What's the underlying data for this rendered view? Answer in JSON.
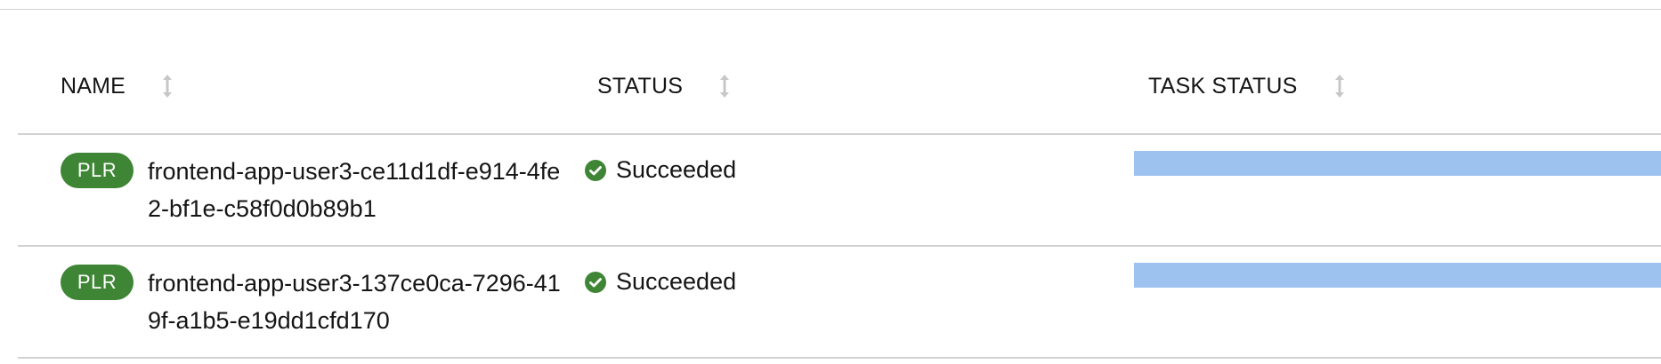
{
  "table": {
    "columns": [
      {
        "label": "NAME"
      },
      {
        "label": "STATUS"
      },
      {
        "label": "TASK STATUS"
      }
    ],
    "rows": [
      {
        "badge": "PLR",
        "name": "frontend-app-user3-ce11d1df-e914-4fe2-bf1e-c58f0d0b89b1",
        "status": "Succeeded",
        "task_progress": 1.0
      },
      {
        "badge": "PLR",
        "name": "frontend-app-user3-137ce0ca-7296-419f-a1b5-e19dd1cfd170",
        "status": "Succeeded",
        "task_progress": 1.0
      }
    ]
  },
  "colors": {
    "badge_bg": "#3e8635",
    "success": "#3e8635",
    "progress": "#9ec2f0",
    "divider": "#d2d2d2"
  },
  "icons": {
    "sort": "sort-icon",
    "status": "check-circle-icon"
  }
}
